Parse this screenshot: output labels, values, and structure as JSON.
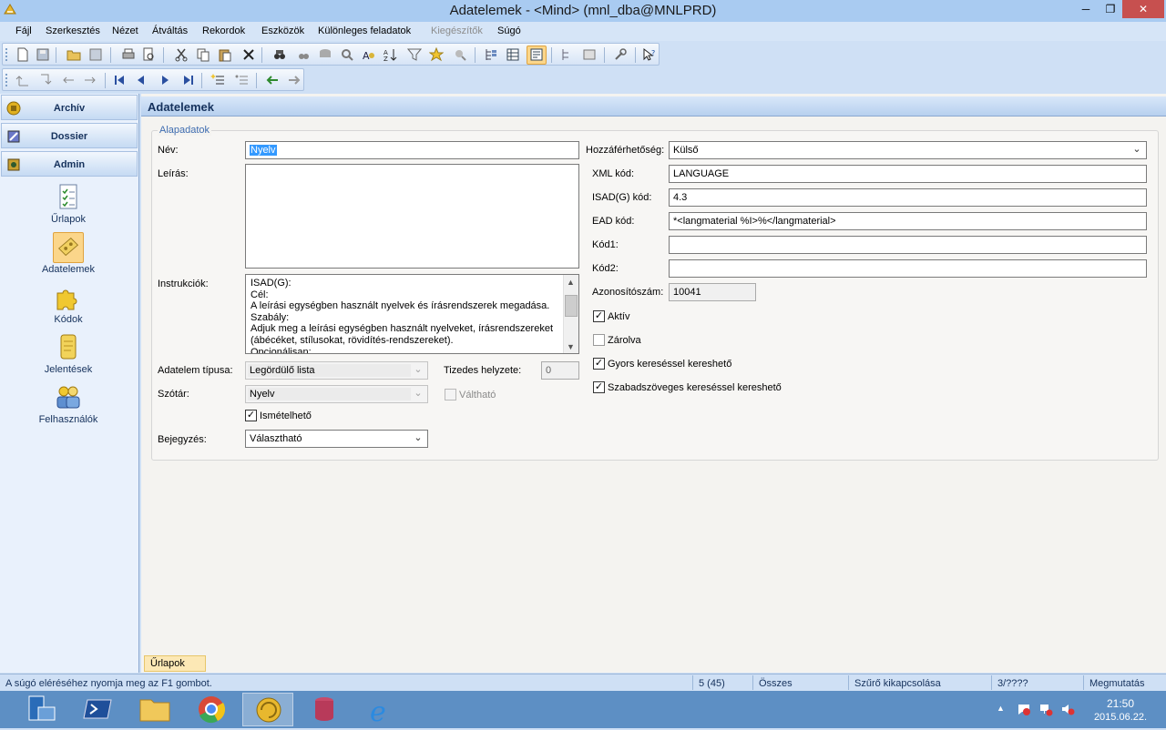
{
  "window": {
    "title": "Adatelemek - <Mind> (mnl_dba@MNLPRD)"
  },
  "menu": {
    "items": [
      {
        "label": "Fájl",
        "enabled": true
      },
      {
        "label": "Szerkesztés",
        "enabled": true
      },
      {
        "label": "Nézet",
        "enabled": true
      },
      {
        "label": "Átváltás",
        "enabled": true
      },
      {
        "label": "Rekordok",
        "enabled": true
      },
      {
        "label": "Eszközök",
        "enabled": true
      },
      {
        "label": "Különleges feladatok",
        "enabled": true
      },
      {
        "label": "Kiegészítők",
        "enabled": false
      },
      {
        "label": "Súgó",
        "enabled": true
      }
    ]
  },
  "sidebar": {
    "groups": [
      {
        "label": "Archív"
      },
      {
        "label": "Dossier"
      },
      {
        "label": "Admin"
      }
    ],
    "items": [
      {
        "label": "Űrlapok",
        "icon": "form-checklist-icon"
      },
      {
        "label": "Adatelemek",
        "icon": "data-elements-icon",
        "selected": true
      },
      {
        "label": "Kódok",
        "icon": "puzzle-icon"
      },
      {
        "label": "Jelentések",
        "icon": "scroll-icon"
      },
      {
        "label": "Felhasználók",
        "icon": "users-icon"
      }
    ]
  },
  "main": {
    "header": "Adatelemek",
    "group_legend": "Alapadatok",
    "left": {
      "nev_label": "Név:",
      "nev_value": "Nyelv",
      "leiras_label": "Leírás:",
      "leiras_value": "",
      "instrukciok_label": "Instrukciók:",
      "instrukciok_value": "ISAD(G):\nCél:\nA leírási egységben használt nyelvek és írásrendszerek megadása.\nSzabály:\nAdjuk meg a leírási egységben használt nyelveket, írásrendszereket\n(ábécéket, stílusokat, rövidítés-rendszereket).\nOpcionálisan:",
      "tipus_label": "Adatelem típusa:",
      "tipus_value": "Legördülő lista",
      "tizedes_label": "Tizedes helyzete:",
      "tizedes_value": "0",
      "szotar_label": "Szótár:",
      "szotar_value": "Nyelv",
      "valthato_label": "Váltható",
      "valthato_checked": false,
      "ismetelheto_label": "Ismételhető",
      "ismetelheto_checked": true,
      "bejegyzes_label": "Bejegyzés:",
      "bejegyzes_value": "Választható"
    },
    "right": {
      "hozzaferhetoseg_label": "Hozzáférhetőség:",
      "hozzaferhetoseg_value": "Külső",
      "xml_label": "XML kód:",
      "xml_value": "LANGUAGE",
      "isad_label": "ISAD(G) kód:",
      "isad_value": "4.3",
      "ead_label": "EAD kód:",
      "ead_value": "*<langmaterial %I>%</langmaterial>",
      "kod1_label": "Kód1:",
      "kod1_value": "",
      "kod2_label": "Kód2:",
      "kod2_value": "",
      "azonosito_label": "Azonosítószám:",
      "azonosito_value": "10041",
      "aktiv_label": "Aktív",
      "aktiv_checked": true,
      "zarolva_label": "Zárolva",
      "zarolva_checked": false,
      "gyors_label": "Gyors kereséssel kereshető",
      "gyors_checked": true,
      "szabad_label": "Szabadszöveges kereséssel kereshető",
      "szabad_checked": true
    }
  },
  "bottom_tab": "Űrlapok",
  "statusbar": {
    "help": "A súgó eléréséhez nyomja meg az F1 gombot.",
    "count": "5 (45)",
    "all": "Összes",
    "filter": "Szűrő kikapcsolása",
    "page": "3/????",
    "show": "Megmutatás"
  },
  "taskbar": {
    "time": "21:50",
    "date": "2015.06.22."
  },
  "colors": {
    "accent": "#3399ff",
    "selected_bg": "#fbd68a",
    "close_red": "#c7504f",
    "header_text": "#15315c"
  }
}
